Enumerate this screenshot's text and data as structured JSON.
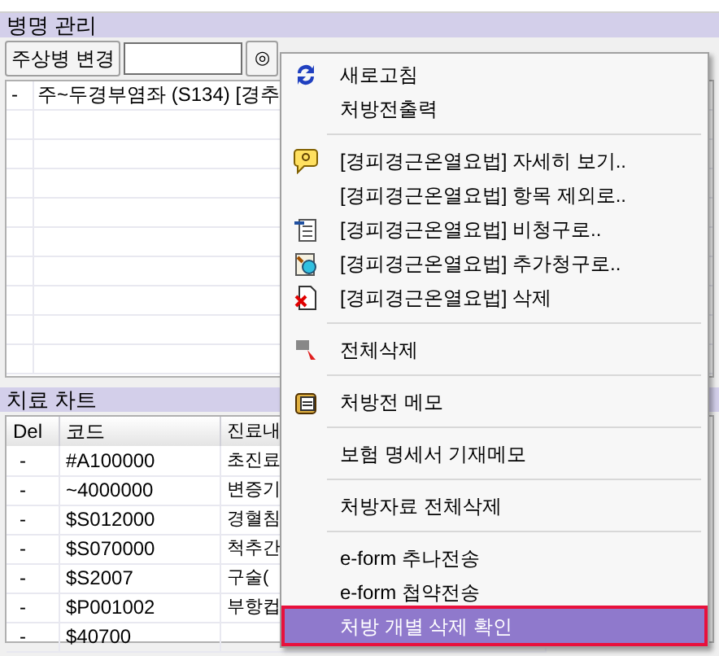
{
  "diagnosis_panel": {
    "title": "병명 관리",
    "change_button": "주상병 변경",
    "option_button": "◎",
    "rows": [
      {
        "del": "-",
        "name": "주~두경부염좌 (S134) [경추"
      }
    ]
  },
  "treatment_chart": {
    "title": "치료 차트",
    "columns": [
      "Del",
      "코드",
      "진료내"
    ],
    "rows": [
      {
        "del": "-",
        "code": "#A100000",
        "name": "초진료"
      },
      {
        "del": "-",
        "code": "~4000000",
        "name": "변증기"
      },
      {
        "del": "-",
        "code": "$S012000",
        "name": "경혈침"
      },
      {
        "del": "-",
        "code": "$S070000",
        "name": "척추간"
      },
      {
        "del": "-",
        "code": "$S2007",
        "name": "구술("
      },
      {
        "del": "-",
        "code": "$P001002",
        "name": "부항컵"
      },
      {
        "del": "-",
        "code": "$40700"
      }
    ]
  },
  "context_menu": [
    {
      "kind": "item",
      "label": "새로고침",
      "selected": false
    },
    {
      "kind": "item",
      "label": "처방전출력",
      "selected": false
    },
    {
      "kind": "separator"
    },
    {
      "kind": "item",
      "label": "[경피경근온열요법] 자세히 보기..",
      "selected": false
    },
    {
      "kind": "item",
      "label": "[경피경근온열요법] 항목 제외로..",
      "selected": false
    },
    {
      "kind": "item",
      "label": "[경피경근온열요법] 비청구로..",
      "selected": false
    },
    {
      "kind": "item",
      "label": "[경피경근온열요법] 추가청구로..",
      "selected": false
    },
    {
      "kind": "item",
      "label": "[경피경근온열요법] 삭제",
      "selected": false
    },
    {
      "kind": "separator"
    },
    {
      "kind": "item",
      "label": "전체삭제",
      "selected": false
    },
    {
      "kind": "separator"
    },
    {
      "kind": "item",
      "label": "처방전 메모",
      "selected": false
    },
    {
      "kind": "separator"
    },
    {
      "kind": "item",
      "label": "보험 명세서 기재메모",
      "selected": false
    },
    {
      "kind": "separator"
    },
    {
      "kind": "item",
      "label": "처방자료 전체삭제",
      "selected": false
    },
    {
      "kind": "separator"
    },
    {
      "kind": "item",
      "label": "e-form 추나전송",
      "selected": false
    },
    {
      "kind": "item",
      "label": "e-form 첩약전송",
      "selected": false
    },
    {
      "kind": "item",
      "label": "처방 개별 삭제 확인",
      "selected": true
    }
  ]
}
